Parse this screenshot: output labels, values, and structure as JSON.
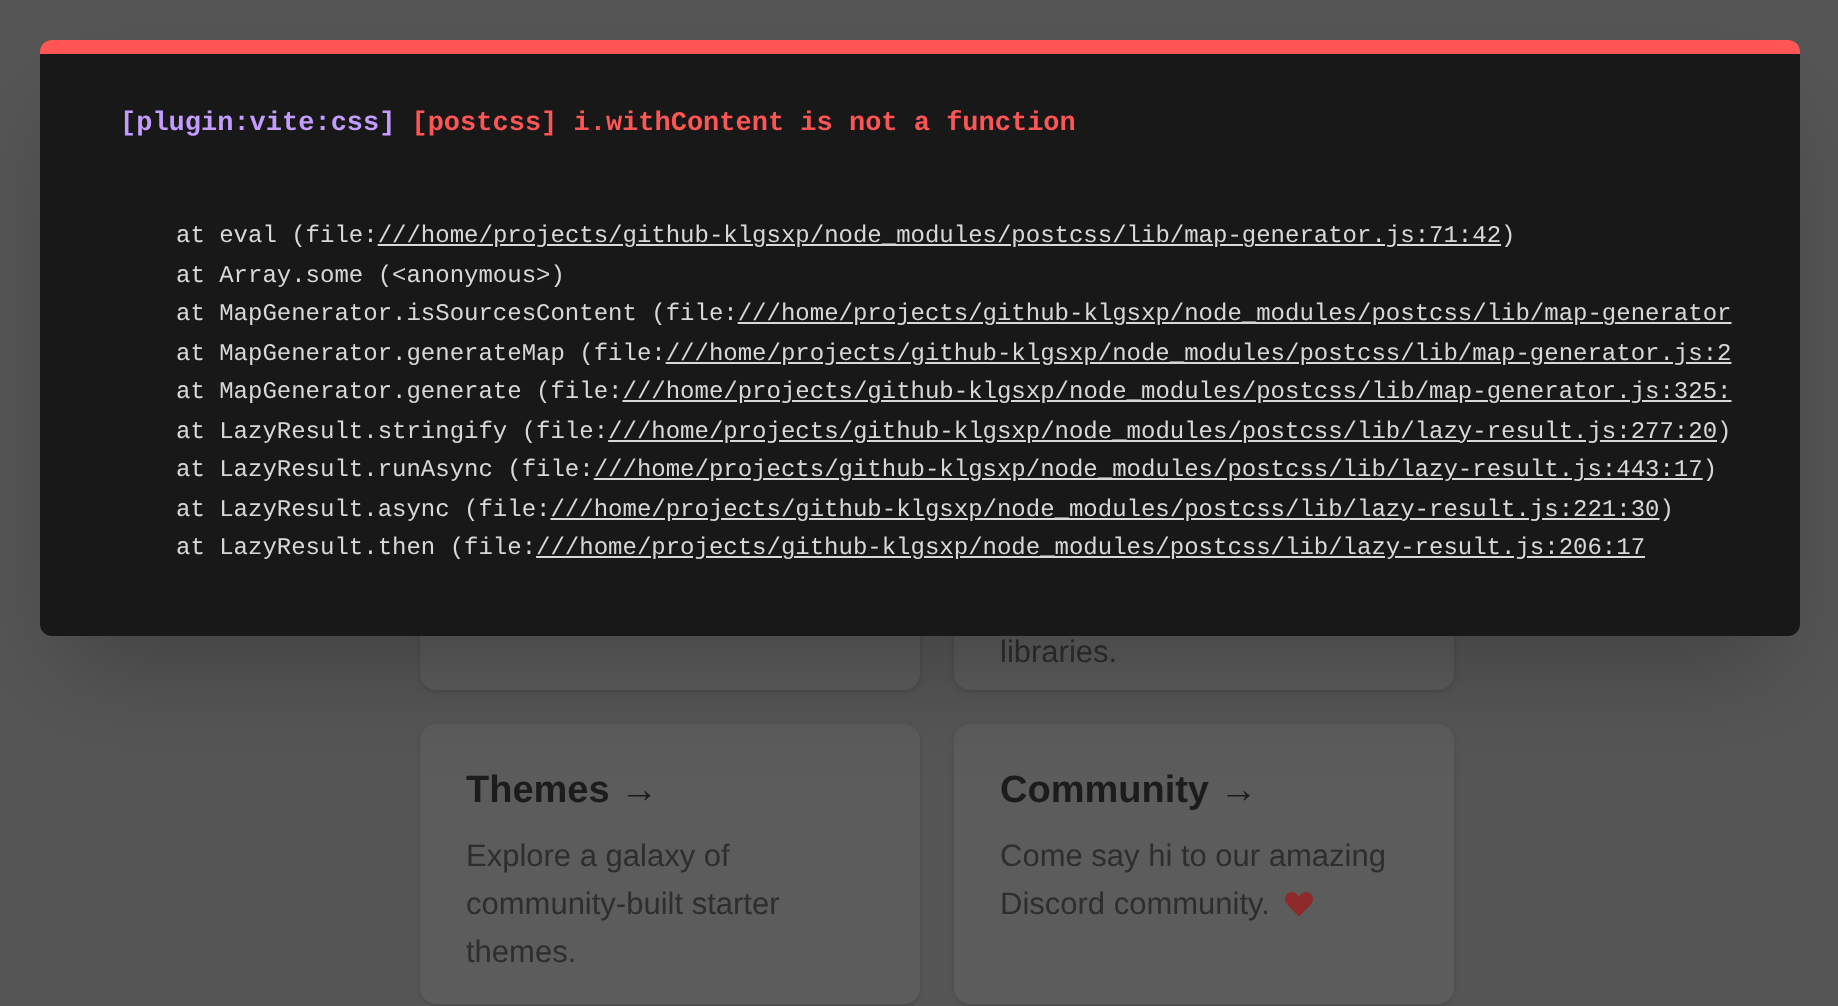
{
  "error_overlay": {
    "plugin": "[plugin:vite:css]",
    "message": "[postcss] i.withContent is not a function",
    "stack": [
      {
        "prefix": "at eval (file:",
        "link": "///home/projects/github-klgsxp/node_modules/postcss/lib/map-generator.js:71:42",
        "suffix": ")"
      },
      {
        "prefix": "at Array.some (<anonymous>)"
      },
      {
        "prefix": "at MapGenerator.isSourcesContent (file:",
        "link": "///home/projects/github-klgsxp/node_modules/postcss/lib/map-generator"
      },
      {
        "prefix": "at MapGenerator.generateMap (file:",
        "link": "///home/projects/github-klgsxp/node_modules/postcss/lib/map-generator.js:2"
      },
      {
        "prefix": "at MapGenerator.generate (file:",
        "link": "///home/projects/github-klgsxp/node_modules/postcss/lib/map-generator.js:325:"
      },
      {
        "prefix": "at LazyResult.stringify (file:",
        "link": "///home/projects/github-klgsxp/node_modules/postcss/lib/lazy-result.js:277:20",
        "suffix": ")"
      },
      {
        "prefix": "at LazyResult.runAsync (file:",
        "link": "///home/projects/github-klgsxp/node_modules/postcss/lib/lazy-result.js:443:17",
        "suffix": ")"
      },
      {
        "prefix": "at LazyResult.async (file:",
        "link": "///home/projects/github-klgsxp/node_modules/postcss/lib/lazy-result.js:221:30",
        "suffix": ")"
      },
      {
        "prefix": "at LazyResult.then (file:",
        "link": "///home/projects/github-klgsxp/node_modules/postcss/lib/lazy-result.js:206:17"
      }
    ]
  },
  "cards": [
    {
      "text": "libraries."
    },
    {
      "title": "Themes →",
      "text": "Explore a galaxy of community-built starter themes.",
      "heart": false
    },
    {
      "title": "Community →",
      "text": "Come say hi to our amazing Discord community.",
      "heart": true
    }
  ]
}
